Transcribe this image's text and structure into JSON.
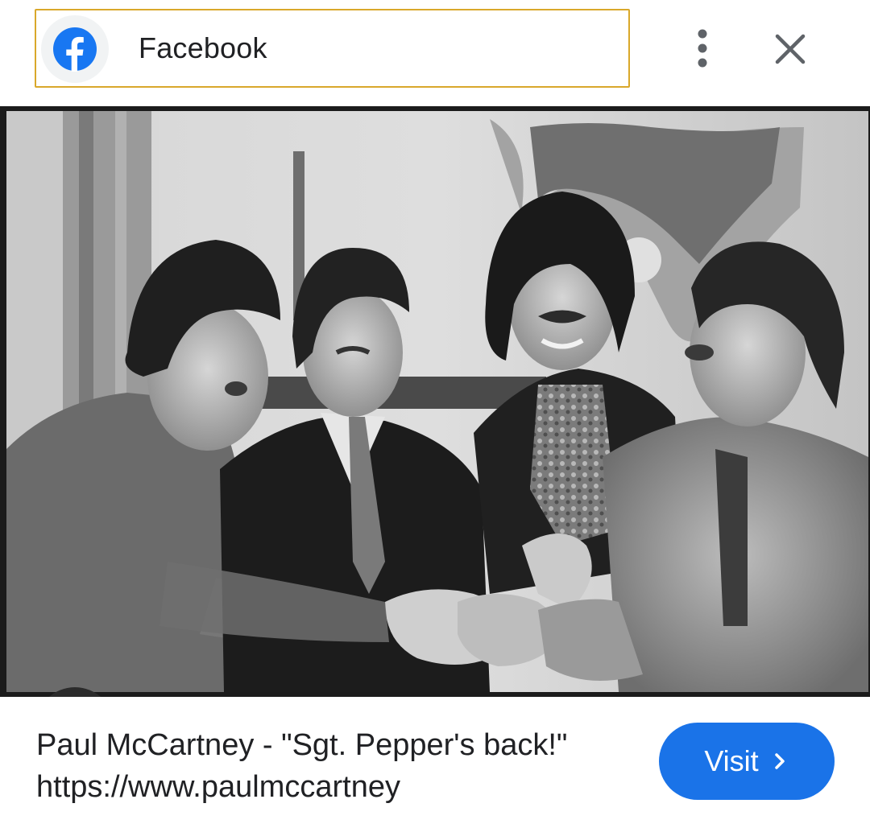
{
  "header": {
    "source_name": "Facebook",
    "favicon_icon": "facebook-f-icon",
    "brand_color": "#1877f2",
    "chip_border_color": "#d9a82b",
    "more_icon": "more-vert-icon",
    "close_icon": "close-icon"
  },
  "image": {
    "lens_icon": "google-lens-icon"
  },
  "result": {
    "caption": "Paul McCartney - \"Sgt. Pepper's back!\" https://www.paulmccartney",
    "visit_label": "Visit",
    "visit_color": "#1a73e8",
    "visit_icon": "chevron-right-icon"
  }
}
